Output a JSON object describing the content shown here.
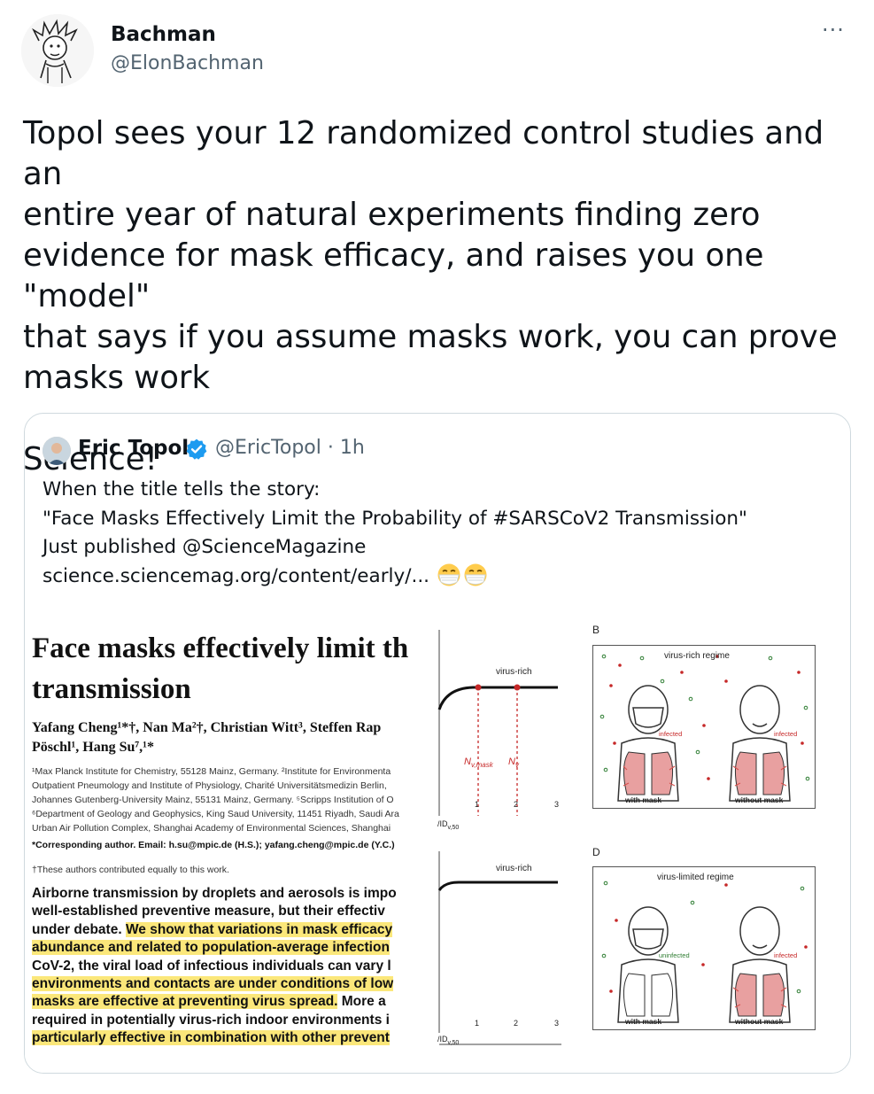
{
  "author": {
    "name": "Bachman",
    "handle": "@ElonBachman",
    "avatar_icon": "calvin-cartoon-avatar"
  },
  "more_icon": "···",
  "tweet_text": "Topol sees your 12 randomized control studies and an\nentire year of natural experiments finding zero\nevidence for mask efficacy, and raises you one \"model\"\nthat says if you assume masks work, you can prove\nmasks work\n\nScience!",
  "quoted": {
    "name": "Eric Topol",
    "handle": "@EricTopol",
    "time": "· 1h",
    "verified": true,
    "text": "When the title tells the story:\n\"Face Masks Effectively Limit the Probability of #SARSCoV2 Transmission\"\nJust published @ScienceMagazine\nscience.sciencemag.org/content/early/... ",
    "emoji_icons": [
      "face-with-medical-mask-icon",
      "face-with-medical-mask-icon"
    ],
    "image": {
      "paper_title": "Face masks effectively limit th\ntransmission",
      "authors": "Yafang Cheng¹*†, Nan Ma²†, Christian Witt³, Steffen Rap\nPöschl¹, Hang Su⁷,¹*",
      "affiliations": "¹Max Planck Institute for Chemistry, 55128 Mainz, Germany. ²Institute for Environmenta\nOutpatient Pneumology and Institute of Physiology, Charité Universitätsmedizin Berlin,\nJohannes Gutenberg-University Mainz, 55131 Mainz, Germany. ⁵Scripps Institution of O\n⁶Department of Geology and Geophysics, King Saud University, 11451 Riyadh, Saudi Ara\nUrban Air Pollution Complex, Shanghai Academy of Environmental Sciences, Shanghai",
      "corresponding": "*Corresponding author. Email: h.su@mpic.de (H.S.); yafang.cheng@mpic.de (Y.C.)",
      "equal_contribution": "†These authors contributed equally to this work.",
      "abstract_lines": [
        {
          "text": "Airborne transmission by droplets and aerosols is impo",
          "pre": "",
          "hl": "",
          "post": ""
        },
        {
          "text": "well-established preventive measure, but their effectiv",
          "pre": "",
          "hl": "",
          "post": ""
        },
        {
          "pre": "under debate. ",
          "hl": "We show that variations in mask efficacy",
          "post": ""
        },
        {
          "pre": "",
          "hl": "abundance and related to population-average infection",
          "post": ""
        },
        {
          "text": "CoV-2, the viral load of infectious individuals can vary l",
          "pre": "",
          "hl": "",
          "post": ""
        },
        {
          "pre": "",
          "hl": "environments and contacts are under conditions of low",
          "post": ""
        },
        {
          "pre": "",
          "hl": "masks are effective at preventing virus spread.",
          "post": " More a"
        },
        {
          "text": "required in potentially virus-rich indoor environments i",
          "pre": "",
          "hl": "",
          "post": ""
        },
        {
          "pre": "",
          "hl": "particularly effective in combination with other prevent",
          "post": ""
        }
      ],
      "graph_top": {
        "label": "virus-rich",
        "marker_mask": "N",
        "marker_mask_sub": "v,mask",
        "marker_plain": "N",
        "marker_plain_sub": "v",
        "ticks": [
          "1",
          "2",
          "3"
        ],
        "axis_label": "/ID",
        "axis_label_sub": "v,50"
      },
      "graph_bottom": {
        "label": "virus-rich",
        "ticks": [
          "1",
          "2",
          "3"
        ],
        "axis_label": "/ID",
        "axis_label_sub": "v,50"
      },
      "panel_b": {
        "letter": "B",
        "title": "virus-rich regime",
        "left_label": "with mask",
        "right_label": "without mask",
        "left_state": "infected",
        "right_state": "infected"
      },
      "panel_d": {
        "letter": "D",
        "title": "virus-limited regime",
        "left_label": "with mask",
        "right_label": "without mask",
        "left_state": "uninfected",
        "right_state": "infected"
      }
    }
  }
}
